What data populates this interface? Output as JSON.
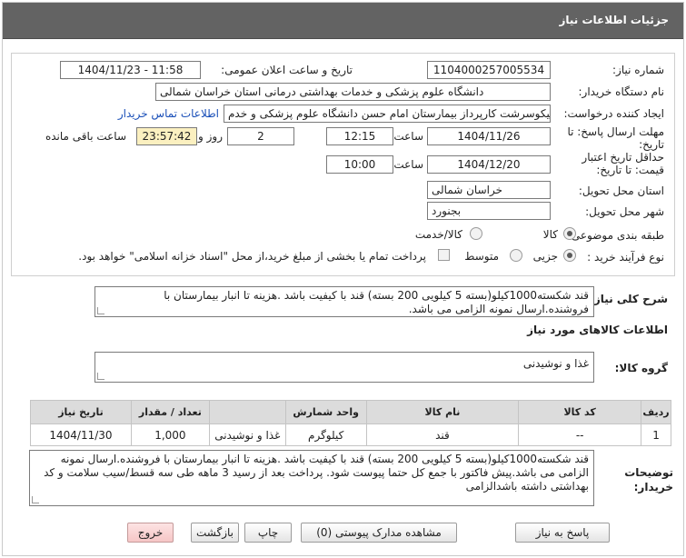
{
  "header": {
    "title": "جزئیات اطلاعات نیاز"
  },
  "fields": {
    "need_number_label": "شماره نیاز:",
    "need_number": "1104000257005534",
    "announce_label": "تاریخ و ساعت اعلان عمومی:",
    "announce_value": "1404/11/23 - 11:58",
    "buyer_org_label": "نام دستگاه خریدار:",
    "buyer_org": "دانشگاه علوم پزشکی و خدمات بهداشتی درمانی استان خراسان شمالی",
    "creator_label": "ایجاد کننده درخواست:",
    "creator": "کوروش نیکوسرشت کارپرداز بیمارستان امام حسن دانشگاه علوم پزشکی و خدم",
    "contact_link": "اطلاعات تماس خریدار",
    "send_deadline_label_1": "مهلت ارسال پاسخ: تا",
    "send_deadline_label_2": "تاریخ:",
    "send_deadline_date": "1404/11/26",
    "time_label": "ساعت",
    "send_deadline_time": "12:15",
    "days_value": "2",
    "days_and_label": "روز و",
    "remaining_time": "23:57:42",
    "remaining_label": "ساعت باقی مانده",
    "validity_label_1": "حداقل تاریخ اعتبار",
    "validity_label_2": "قیمت: تا تاریخ:",
    "validity_date": "1404/12/20",
    "validity_time": "10:00",
    "province_label": "استان محل تحویل:",
    "province": "خراسان شمالی",
    "city_label": "شهر محل تحویل:",
    "city": "بجنورد",
    "category_label": "طبقه بندی موضوعی:",
    "category_goods": "کالا",
    "category_goods_service": "کالا/خدمت",
    "process_label": "نوع فرآیند خرید :",
    "process_minor": "جزیی",
    "process_medium": "متوسط",
    "process_note": "پرداخت تمام یا بخشی از مبلغ خرید،از محل \"اسناد خزانه اسلامی\" خواهد بود."
  },
  "summary": {
    "label": "شرح کلی نیاز:",
    "text": "قند شکسته1000کیلو(بسته 5 کیلویی 200 بسته) قند با کیفیت باشد .هزینه تا انبار بیمارستان با فروشنده.ارسال نمونه الزامی می باشد."
  },
  "goods_info": {
    "title": "اطلاعات کالاهای مورد نیاز",
    "group_label": "گروه کالا:",
    "group_value": "غذا و نوشیدنی"
  },
  "table": {
    "headers": [
      "ردیف",
      "کد کالا",
      "نام کالا",
      "واحد شمارش",
      "تعداد / مقدار",
      "تاریخ نیاز"
    ],
    "rows": [
      [
        "1",
        "--",
        "قند",
        "کیلوگرم",
        "غذا و نوشیدنی",
        "1,000",
        "1404/11/30"
      ]
    ],
    "row": {
      "index": "1",
      "code": "--",
      "name": "قند",
      "unit": "کیلوگرم",
      "group": "غذا و نوشیدنی",
      "quantity": "1,000",
      "date": "1404/11/30"
    }
  },
  "buyer_notes": {
    "label_1": "توضیحات",
    "label_2": "خریدار:",
    "text": "قند شکسته1000کیلو(بسته 5 کیلویی 200 بسته) قند با کیفیت باشد .هزینه تا انبار بیمارستان با فروشنده.ارسال نمونه الزامی می باشد.پیش فاکتور با جمع کل حتما پیوست شود. پرداخت بعد از رسید 3 ماهه طی سه قسط/سیب سلامت و کد بهداشتی داشته باشدالزامی"
  },
  "buttons": {
    "reply": "پاسخ به نیاز",
    "attachments": "مشاهده مدارک پیوستی (0)",
    "print": "چاپ",
    "back": "بازگشت",
    "exit": "خروج"
  }
}
